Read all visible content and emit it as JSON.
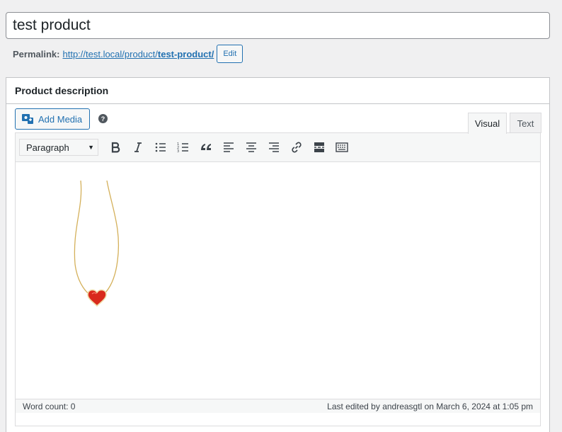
{
  "title": {
    "value": "test product"
  },
  "permalink": {
    "label": "Permalink:",
    "url_base": "http://test.local/product/",
    "url_slug": "test-product/",
    "edit_label": "Edit"
  },
  "description": {
    "heading": "Product description",
    "add_media_label": "Add Media",
    "help_glyph": "?",
    "tabs": {
      "visual": "Visual",
      "text": "Text"
    },
    "format_select": "Paragraph",
    "toolbar_icons": [
      "bold-icon",
      "italic-icon",
      "bullet-list-icon",
      "numbered-list-icon",
      "blockquote-icon",
      "align-left-icon",
      "align-center-icon",
      "align-right-icon",
      "link-icon",
      "read-more-icon",
      "toolbar-toggle-icon"
    ],
    "content_image": "heart-necklace"
  },
  "status": {
    "word_count": "Word count: 0",
    "last_edited": "Last edited by andreasgtl on March 6, 2024 at 1:05 pm"
  },
  "colors": {
    "accent": "#2271b1",
    "border": "#dcdcde",
    "bg": "#f0f0f1"
  }
}
